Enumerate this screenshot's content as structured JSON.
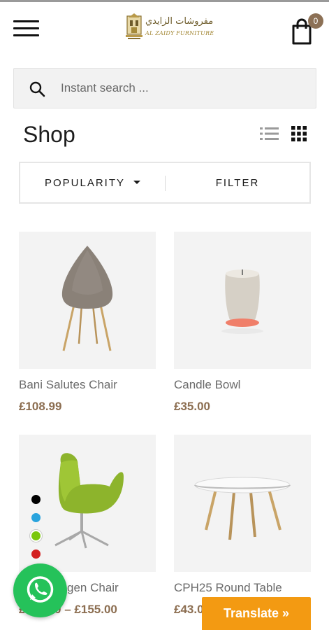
{
  "header": {
    "menu_icon": "hamburger-icon",
    "logo_arabic": "مفروشات الزايدي",
    "logo_latin": "AL ZAIDY FURNITURE",
    "cart_icon": "shopping-bag-icon",
    "cart_count": "0",
    "cart_badge_color": "#8c7055"
  },
  "search": {
    "icon": "search-icon",
    "placeholder": "Instant search ..."
  },
  "shop": {
    "title": "Shop",
    "list_view_icon": "list-view-icon",
    "grid_view_icon": "grid-view-icon"
  },
  "toolbar": {
    "sort_label": "POPULARITY",
    "filter_label": "FILTER"
  },
  "products": [
    {
      "name": "Bani Salutes Chair",
      "price": "£108.99"
    },
    {
      "name": "Candle Bowl",
      "price": "£35.00"
    },
    {
      "name": "Copenhagen Chair",
      "price": "£110.00 – £155.00",
      "swatches": [
        "#000000",
        "#29a3dd",
        "#7ac70c",
        "#d32020"
      ]
    },
    {
      "name": "CPH25 Round Table",
      "price": "£43.00"
    }
  ],
  "price_color": "#8c6e51",
  "floating": {
    "whatsapp_icon": "whatsapp-icon",
    "whatsapp_color": "#25c25a",
    "translate_label": "Translate »",
    "translate_color": "#f39a12"
  }
}
